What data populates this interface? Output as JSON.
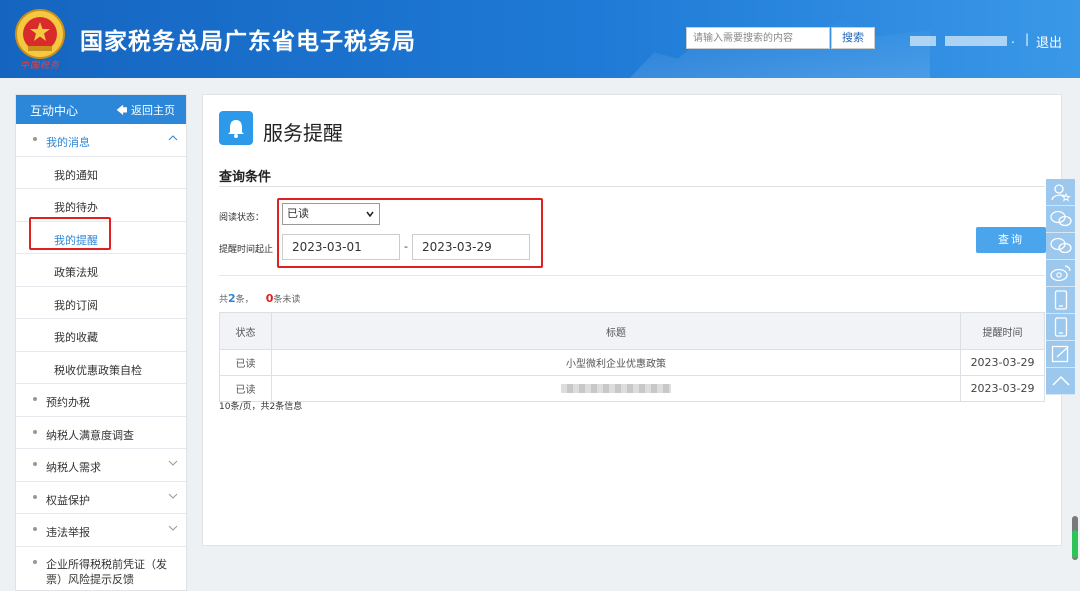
{
  "header": {
    "site_title": "国家税务总局广东省电子税务局",
    "emblem_text": "中国税务",
    "search_placeholder": "请输入需要搜索的内容",
    "search_button": "搜索",
    "user_suffix": ".",
    "separator": "|",
    "logout": "退出"
  },
  "sidebar": {
    "title": "互动中心",
    "back_label": "返回主页",
    "items": [
      {
        "label": "我的消息",
        "level": "top",
        "expanded": true,
        "active": true
      },
      {
        "label": "我的通知",
        "level": "sub"
      },
      {
        "label": "我的待办",
        "level": "sub"
      },
      {
        "label": "我的提醒",
        "level": "sub",
        "active": true
      },
      {
        "label": "政策法规",
        "level": "sub"
      },
      {
        "label": "我的订阅",
        "level": "sub"
      },
      {
        "label": "我的收藏",
        "level": "sub"
      },
      {
        "label": "税收优惠政策自检",
        "level": "sub"
      },
      {
        "label": "预约办税",
        "level": "top"
      },
      {
        "label": "纳税人满意度调查",
        "level": "top"
      },
      {
        "label": "纳税人需求",
        "level": "top",
        "chevron": true
      },
      {
        "label": "权益保护",
        "level": "top",
        "chevron": true
      },
      {
        "label": "违法举报",
        "level": "top",
        "chevron": true
      },
      {
        "label": "企业所得税税前凭证（发票）风险提示反馈",
        "level": "top"
      }
    ]
  },
  "main": {
    "page_title": "服务提醒",
    "section_title": "查询条件",
    "read_status_label": "阅读状态：",
    "read_status_value": "已读",
    "time_range_label": "提醒时间起止",
    "date_from": "2023-03-01",
    "date_separator": "-",
    "date_to": "2023-03-29",
    "query_button": "查询",
    "summary_prefix": "共",
    "summary_total": "2",
    "summary_mid": "条，",
    "summary_unread": "0",
    "summary_suffix": "条未读",
    "table": {
      "headers": [
        "状态",
        "标题",
        "提醒时间"
      ],
      "rows": [
        {
          "status": "已读",
          "title": "小型微利企业优惠政策",
          "time": "2023-03-29"
        },
        {
          "status": "已读",
          "title": "",
          "time": "2023-03-29"
        }
      ]
    },
    "pager": "10条/页，共2条信息"
  },
  "colors": {
    "header_blue": "#1e7ad6",
    "accent_blue": "#2c87d9",
    "highlight_red": "#e02020",
    "button_blue": "#4ba5ec"
  },
  "right_toolbar": [
    "user-star-icon",
    "wechat-icon",
    "wechat-icon",
    "weibo-icon",
    "mobile-icon",
    "mobile-icon",
    "edit-icon",
    "chevron-up-icon"
  ]
}
